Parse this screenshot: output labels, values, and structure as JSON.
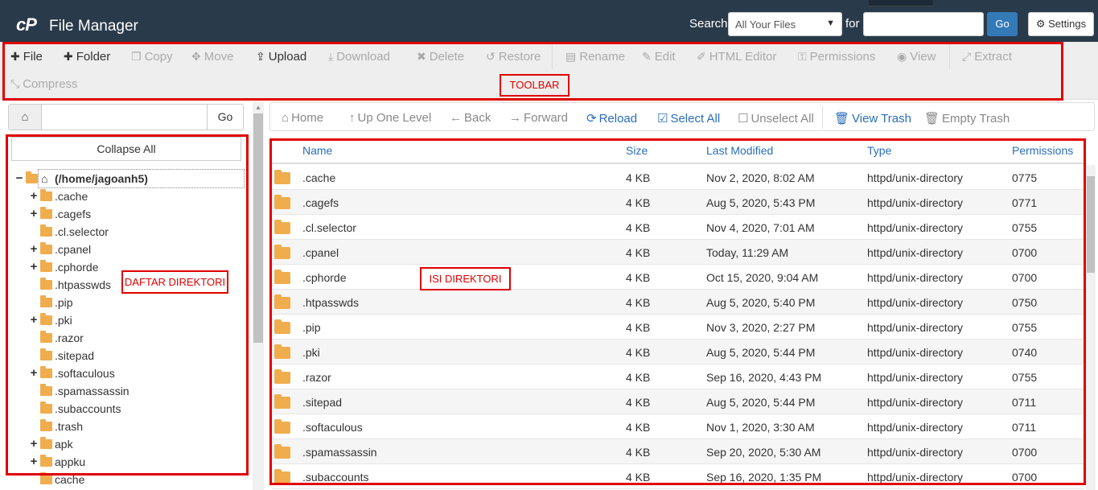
{
  "header": {
    "logo": "cP",
    "title": "File Manager",
    "search_label": "Search",
    "search_scope": "All Your Files",
    "for_label": "for",
    "search_value": "",
    "go_label": "Go",
    "settings_label": "Settings"
  },
  "toolbar": {
    "file": "File",
    "folder": "Folder",
    "copy": "Copy",
    "move": "Move",
    "upload": "Upload",
    "download": "Download",
    "delete": "Delete",
    "restore": "Restore",
    "rename": "Rename",
    "edit": "Edit",
    "html_editor": "HTML Editor",
    "permissions": "Permissions",
    "view": "View",
    "extract": "Extract",
    "compress": "Compress",
    "annotation": "TOOLBAR"
  },
  "sidebar": {
    "path_value": "",
    "go_label": "Go",
    "collapse_label": "Collapse All",
    "root": "(/home/jagoanh5)",
    "annotation": "DAFTAR DIREKTORI",
    "items": [
      {
        "name": ".cache",
        "expandable": "+"
      },
      {
        "name": ".cagefs",
        "expandable": "+"
      },
      {
        "name": ".cl.selector",
        "expandable": ""
      },
      {
        "name": ".cpanel",
        "expandable": "+"
      },
      {
        "name": ".cphorde",
        "expandable": "+"
      },
      {
        "name": ".htpasswds",
        "expandable": ""
      },
      {
        "name": ".pip",
        "expandable": ""
      },
      {
        "name": ".pki",
        "expandable": "+"
      },
      {
        "name": ".razor",
        "expandable": ""
      },
      {
        "name": ".sitepad",
        "expandable": ""
      },
      {
        "name": ".softaculous",
        "expandable": "+"
      },
      {
        "name": ".spamassassin",
        "expandable": ""
      },
      {
        "name": ".subaccounts",
        "expandable": ""
      },
      {
        "name": ".trash",
        "expandable": ""
      },
      {
        "name": "apk",
        "expandable": "+"
      },
      {
        "name": "appku",
        "expandable": "+"
      },
      {
        "name": "cache",
        "expandable": ""
      }
    ]
  },
  "nav": {
    "home": "Home",
    "up": "Up One Level",
    "back": "Back",
    "forward": "Forward",
    "reload": "Reload",
    "select_all": "Select All",
    "unselect_all": "Unselect All",
    "view_trash": "View Trash",
    "empty_trash": "Empty Trash"
  },
  "table": {
    "annotation": "ISI DIREKTORI",
    "headers": {
      "name": "Name",
      "size": "Size",
      "modified": "Last Modified",
      "type": "Type",
      "perm": "Permissions"
    },
    "rows": [
      {
        "name": ".cache",
        "size": "4 KB",
        "modified": "Nov 2, 2020, 8:02 AM",
        "type": "httpd/unix-directory",
        "perm": "0775"
      },
      {
        "name": ".cagefs",
        "size": "4 KB",
        "modified": "Aug 5, 2020, 5:43 PM",
        "type": "httpd/unix-directory",
        "perm": "0771"
      },
      {
        "name": ".cl.selector",
        "size": "4 KB",
        "modified": "Nov 4, 2020, 7:01 AM",
        "type": "httpd/unix-directory",
        "perm": "0755"
      },
      {
        "name": ".cpanel",
        "size": "4 KB",
        "modified": "Today, 11:29 AM",
        "type": "httpd/unix-directory",
        "perm": "0700"
      },
      {
        "name": ".cphorde",
        "size": "4 KB",
        "modified": "Oct 15, 2020, 9:04 AM",
        "type": "httpd/unix-directory",
        "perm": "0700"
      },
      {
        "name": ".htpasswds",
        "size": "4 KB",
        "modified": "Aug 5, 2020, 5:40 PM",
        "type": "httpd/unix-directory",
        "perm": "0750"
      },
      {
        "name": ".pip",
        "size": "4 KB",
        "modified": "Nov 3, 2020, 2:27 PM",
        "type": "httpd/unix-directory",
        "perm": "0755"
      },
      {
        "name": ".pki",
        "size": "4 KB",
        "modified": "Aug 5, 2020, 5:44 PM",
        "type": "httpd/unix-directory",
        "perm": "0740"
      },
      {
        "name": ".razor",
        "size": "4 KB",
        "modified": "Sep 16, 2020, 4:43 PM",
        "type": "httpd/unix-directory",
        "perm": "0755"
      },
      {
        "name": ".sitepad",
        "size": "4 KB",
        "modified": "Aug 5, 2020, 5:44 PM",
        "type": "httpd/unix-directory",
        "perm": "0711"
      },
      {
        "name": ".softaculous",
        "size": "4 KB",
        "modified": "Nov 1, 2020, 3:30 AM",
        "type": "httpd/unix-directory",
        "perm": "0711"
      },
      {
        "name": ".spamassassin",
        "size": "4 KB",
        "modified": "Sep 20, 2020, 5:30 AM",
        "type": "httpd/unix-directory",
        "perm": "0700"
      },
      {
        "name": ".subaccounts",
        "size": "4 KB",
        "modified": "Sep 16, 2020, 1:35 PM",
        "type": "httpd/unix-directory",
        "perm": "0700"
      }
    ]
  },
  "colors": {
    "header_bg": "#293a4a",
    "primary": "#337ab7",
    "link": "#2a6ebb",
    "folder": "#f0ad4e",
    "annotation": "#e00000"
  }
}
